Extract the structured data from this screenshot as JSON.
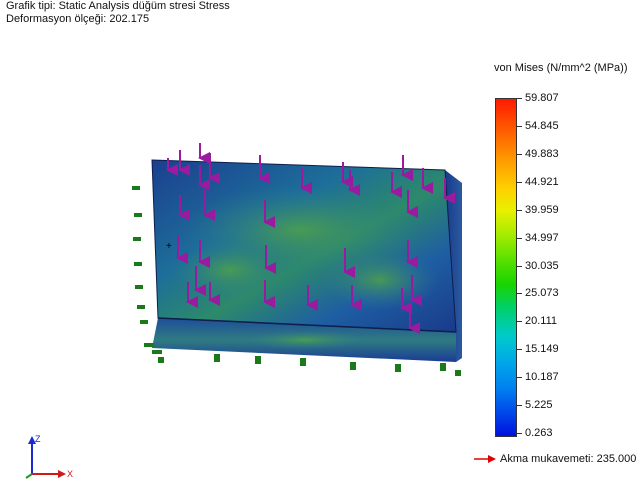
{
  "header": {
    "plot_type": "Grafik tipi: Static Analysis düğüm stresi Stress",
    "deformation_scale": "Deformasyon ölçeği: 202.175"
  },
  "legend": {
    "title": "von Mises (N/mm^2 (MPa))",
    "ticks": [
      "59.807",
      "54.845",
      "49.883",
      "44.921",
      "39.959",
      "34.997",
      "30.035",
      "25.073",
      "20.111",
      "15.149",
      "10.187",
      "5.225",
      "0.263"
    ]
  },
  "yield": {
    "label": "Akma mukavemeti: 235.000",
    "arrow_color": "#e00000"
  },
  "triad": {
    "z_label": "Z",
    "x_label": "X"
  },
  "colors": {
    "load_arrow": "#9a1aa0",
    "fixture": "#1a7a1a"
  }
}
